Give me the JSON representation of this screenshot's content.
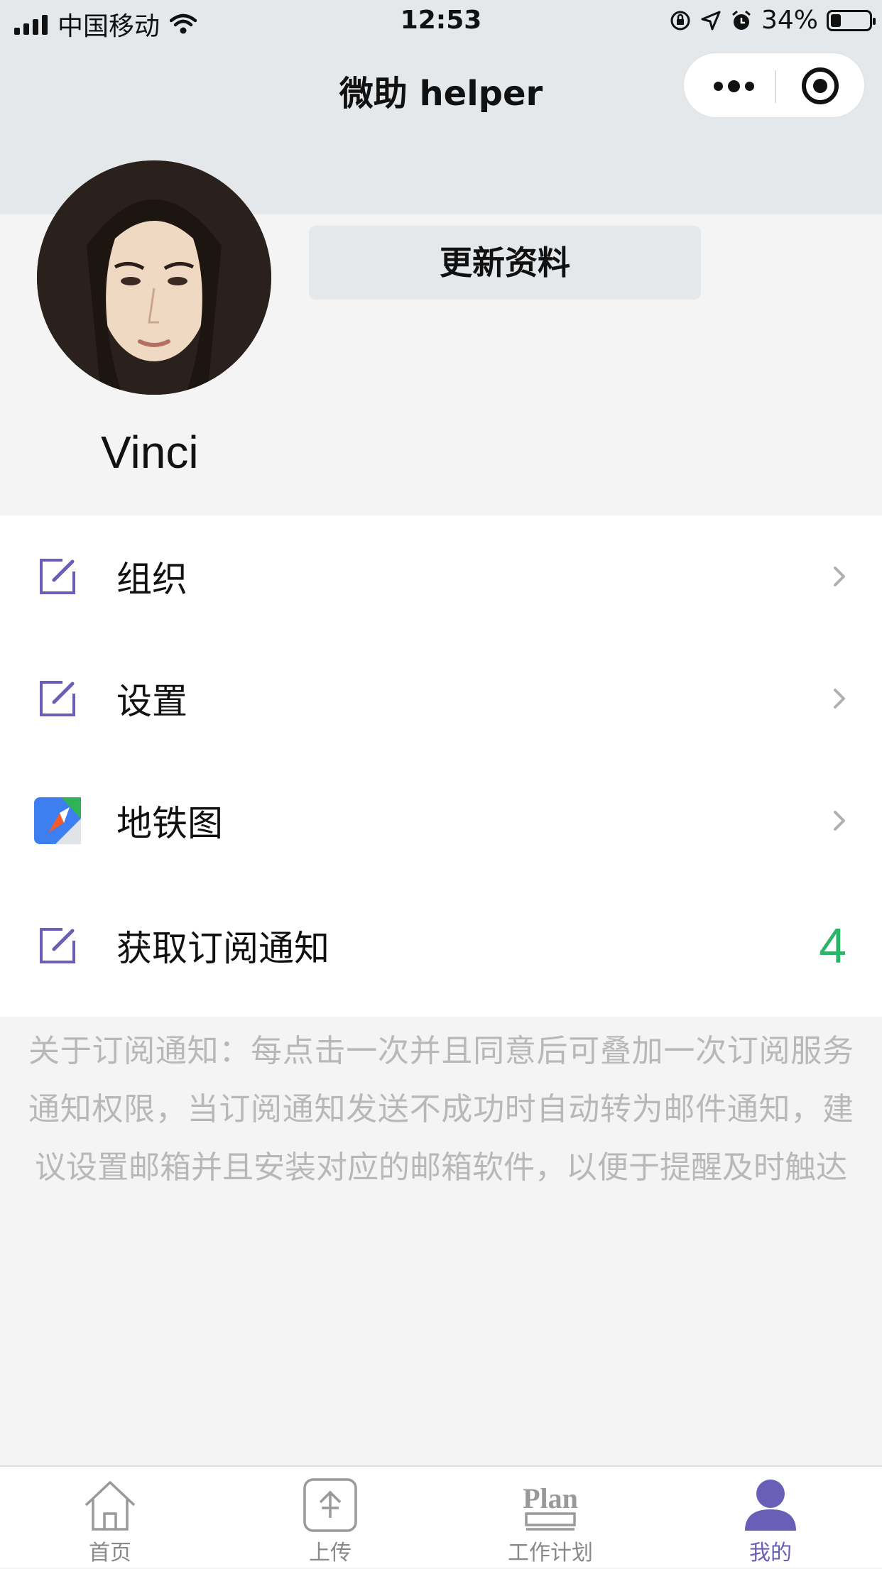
{
  "status_bar": {
    "carrier": "中国移动",
    "time": "12:53",
    "battery": "34%"
  },
  "nav": {
    "title": "微助 helper"
  },
  "profile": {
    "update_button": "更新资料",
    "username": "Vinci"
  },
  "menu": {
    "items": [
      {
        "label": "组织",
        "icon": "edit-icon"
      },
      {
        "label": "设置",
        "icon": "edit-icon"
      },
      {
        "label": "地铁图",
        "icon": "metro-map-icon"
      },
      {
        "label": "获取订阅通知",
        "icon": "edit-icon",
        "count": "4"
      }
    ]
  },
  "note": "关于订阅通知：每点击一次并且同意后可叠加一次订阅服务通知权限，当订阅通知发送不成功时自动转为邮件通知，建议设置邮箱并且安装对应的邮箱软件，以便于提醒及时触达",
  "tabbar": {
    "tabs": [
      {
        "label": "首页",
        "icon": "home-icon"
      },
      {
        "label": "上传",
        "icon": "upload-icon"
      },
      {
        "label": "工作计划",
        "icon": "plan-icon",
        "icon_text": "Plan"
      },
      {
        "label": "我的",
        "icon": "user-icon",
        "active": true
      }
    ]
  },
  "colors": {
    "header_bg": "#e5e8ea",
    "icon_accent": "#6a5fb8",
    "count_color": "#2cb46a",
    "note_text": "#b8b8b8"
  }
}
